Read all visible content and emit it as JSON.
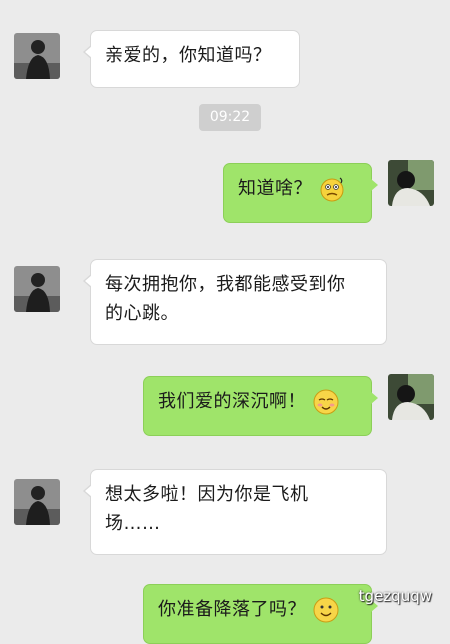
{
  "conversation": {
    "timestamp": "09:22",
    "messages": [
      {
        "sender": "other",
        "text": "亲爱的，你知道吗？",
        "emoji": null
      },
      {
        "sender": "self",
        "text": "知道啥？",
        "emoji": "confused-face-emoji"
      },
      {
        "sender": "other",
        "text": "每次拥抱你，我都能感受到你的心跳。",
        "emoji": null
      },
      {
        "sender": "self",
        "text": "我们爱的深沉啊！",
        "emoji": "blushing-smile-emoji"
      },
      {
        "sender": "other",
        "text": "想太多啦！因为你是飞机场……",
        "emoji": null
      },
      {
        "sender": "self",
        "text": "你准备降落了吗？",
        "emoji": "smile-emoji"
      }
    ]
  },
  "message_lines": {
    "m1": "亲爱的，你知道吗？",
    "m2": "知道啥？",
    "m3_line1": "每次拥抱你，我都能感受到你",
    "m3_line2": "的心跳。",
    "m4": "我们爱的深沉啊！",
    "m5_line1": "想太多啦！因为你是飞机",
    "m5_line2": "场……",
    "m6": "你准备降落了吗？"
  },
  "watermark": "tgezquqw",
  "colors": {
    "background": "#ebebeb",
    "incoming_bubble": "#ffffff",
    "outgoing_bubble": "#9fe46a",
    "timestamp_pill": "#cfcfcf"
  }
}
